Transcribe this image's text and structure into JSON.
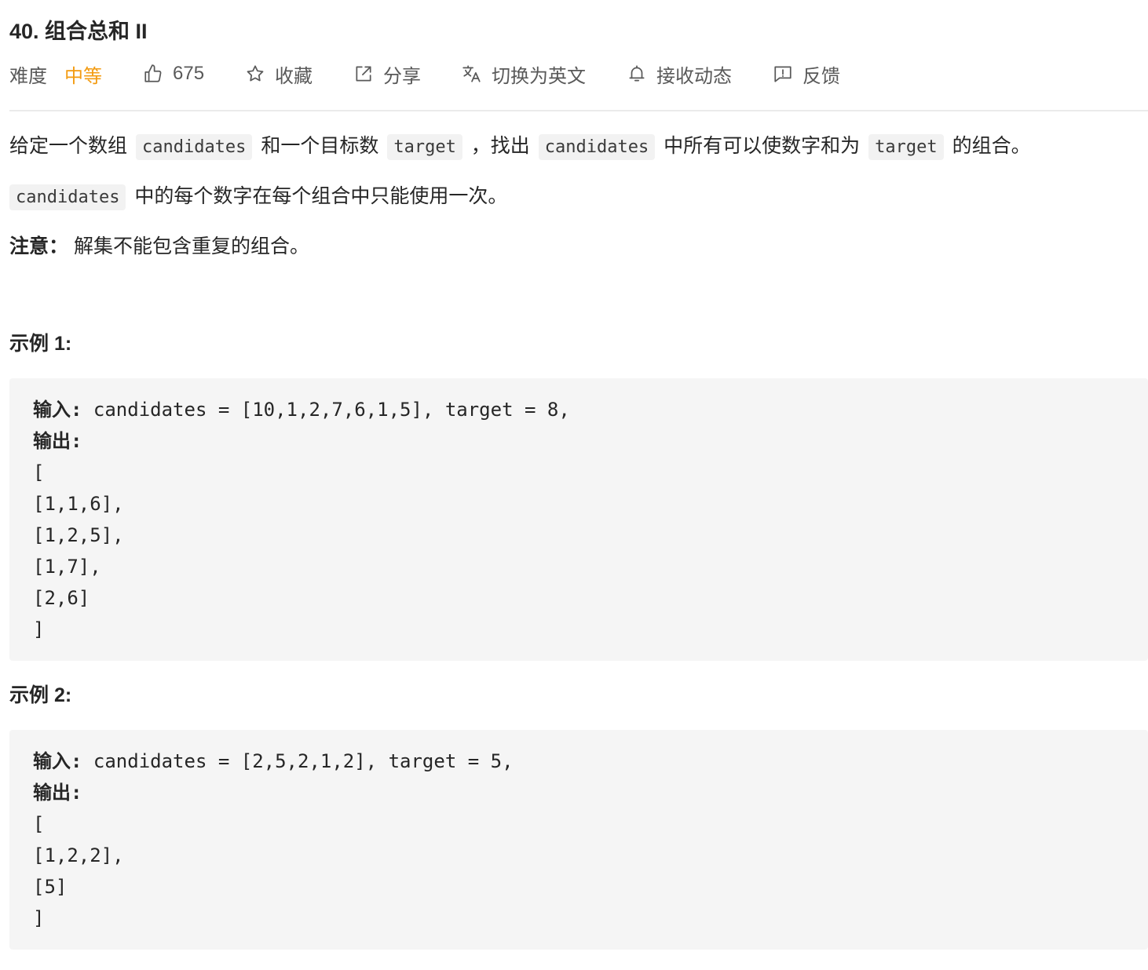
{
  "problem": {
    "title": "40. 组合总和 II"
  },
  "meta": {
    "difficulty_label": "难度",
    "difficulty_value": "中等",
    "likes": "675",
    "favorite": "收藏",
    "share": "分享",
    "switch_language": "切换为英文",
    "subscribe": "接收动态",
    "feedback": "反馈",
    "colors": {
      "difficulty_medium": "#f39b11",
      "text_secondary": "#595959"
    },
    "icons": [
      "thumbs-up-icon",
      "star-icon",
      "share-icon",
      "translate-icon",
      "bell-icon",
      "feedback-icon"
    ]
  },
  "description": {
    "p1": {
      "t1": "给定一个数组",
      "c1": "candidates",
      "t2": "和一个目标数",
      "c2": "target",
      "t3": "，找出",
      "c3": "candidates",
      "t4": "中所有可以使数字和为",
      "c4": "target",
      "t5": "的组合。"
    },
    "p2": {
      "c1": "candidates",
      "t1": "中的每个数字在每个组合中只能使用一次。"
    },
    "p3": {
      "strong": "注意：",
      "t1": "解集不能包含重复的组合。"
    }
  },
  "examples": [
    {
      "title": "示例 1:",
      "input_label": "输入:",
      "input_value": " candidates = [10,1,2,7,6,1,5], target = 8,",
      "output_label": "输出:",
      "output_lines": [
        "[",
        "[1,1,6],",
        "[1,2,5],",
        "[1,7],",
        "[2,6]",
        "]"
      ]
    },
    {
      "title": "示例 2:",
      "input_label": "输入:",
      "input_value": " candidates = [2,5,2,1,2], target = 5,",
      "output_label": "输出:",
      "output_lines": [
        "[",
        "[1,2,2],",
        "[5]",
        "]"
      ]
    }
  ]
}
